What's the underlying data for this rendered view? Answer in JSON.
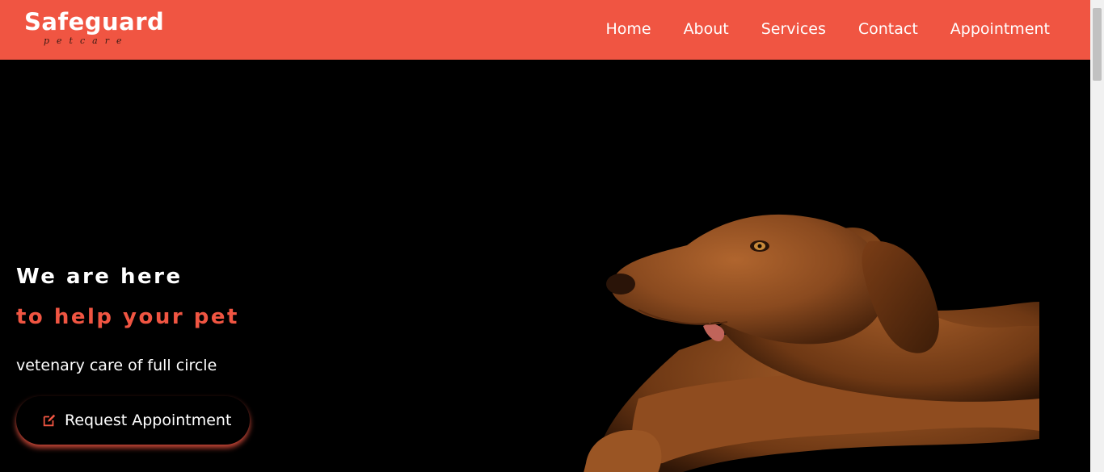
{
  "brand": {
    "name": "Safeguard",
    "tagline": "petcare"
  },
  "nav": {
    "items": [
      {
        "label": "Home"
      },
      {
        "label": "About"
      },
      {
        "label": "Services"
      },
      {
        "label": "Contact"
      },
      {
        "label": "Appointment"
      }
    ]
  },
  "hero": {
    "headline_line1": "We are here",
    "headline_line2": "to help your pet",
    "subtext": "vetenary care of full circle",
    "cta": {
      "label": "Request Appointment",
      "icon": "edit-icon"
    },
    "image": "dog-photo"
  },
  "colors": {
    "accent": "#f05542",
    "background": "#000000",
    "text": "#ffffff"
  }
}
